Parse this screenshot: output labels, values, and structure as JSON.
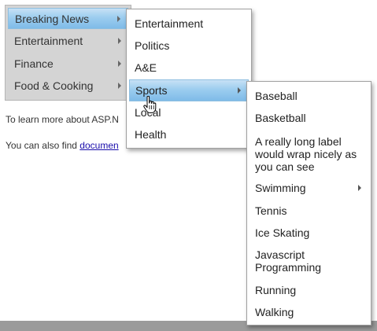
{
  "top_menu": {
    "items": [
      {
        "label": "Breaking News",
        "has_submenu": true,
        "active": true
      },
      {
        "label": "Entertainment",
        "has_submenu": true,
        "active": false
      },
      {
        "label": "Finance",
        "has_submenu": true,
        "active": false
      },
      {
        "label": "Food & Cooking",
        "has_submenu": true,
        "active": false
      }
    ]
  },
  "submenu_1": {
    "items": [
      {
        "label": "Entertainment",
        "has_submenu": false
      },
      {
        "label": "Politics",
        "has_submenu": false
      },
      {
        "label": "A&E",
        "has_submenu": false
      },
      {
        "label": "Sports",
        "has_submenu": true,
        "active": true
      },
      {
        "label": "Local",
        "has_submenu": false
      },
      {
        "label": "Health",
        "has_submenu": false
      }
    ]
  },
  "submenu_2": {
    "items": [
      {
        "label": "Baseball",
        "has_submenu": false
      },
      {
        "label": "Basketball",
        "has_submenu": false
      },
      {
        "label": "A really long label would wrap nicely as you can see",
        "has_submenu": false
      },
      {
        "label": "Swimming",
        "has_submenu": true
      },
      {
        "label": "Tennis",
        "has_submenu": false
      },
      {
        "label": "Ice Skating",
        "has_submenu": false
      },
      {
        "label": "Javascript Programming",
        "has_submenu": false
      },
      {
        "label": "Running",
        "has_submenu": false
      },
      {
        "label": "Walking",
        "has_submenu": false
      }
    ]
  },
  "page": {
    "learn_more_text": "To learn more about ASP.N",
    "also_find_text": "You can also find ",
    "docs_link": "documen"
  },
  "colors": {
    "active_item": "#9ccdef",
    "top_menu_bg": "#d4d4d4",
    "link": "#1a0dab"
  },
  "icons": {
    "cursor": "hand-pointer-icon",
    "submenu_arrow": "chevron-right-icon"
  }
}
